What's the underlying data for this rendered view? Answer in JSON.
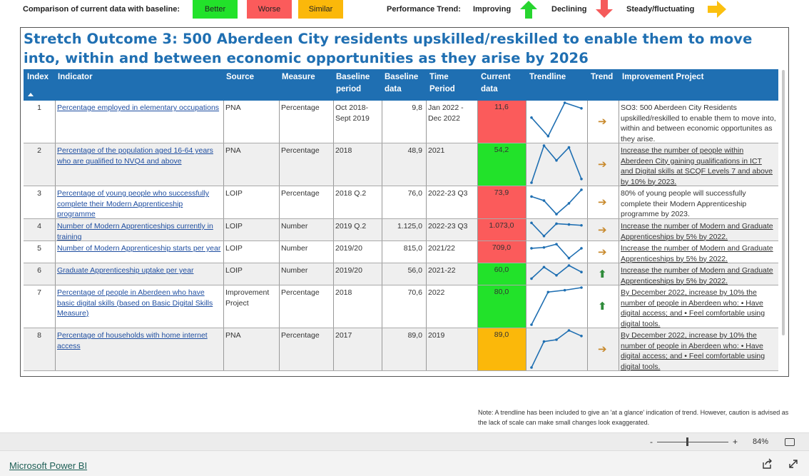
{
  "legend": {
    "comparison_label": "Comparison of current data with baseline:",
    "better": "Better",
    "worse": "Worse",
    "similar": "Similar",
    "performance_label": "Performance Trend:",
    "improving": "Improving",
    "declining": "Declining",
    "steady": "Steady/fluctuating",
    "colors": {
      "better": "#22e22a",
      "worse": "#fb5b5b",
      "similar": "#fbb80a",
      "improving": "#27d52f",
      "declining": "#f55a5a",
      "steady": "#fbc00f"
    }
  },
  "report": {
    "title": "Stretch Outcome 3: 500 Aberdeen City residents upskilled/reskilled to enable them to move into, within and between economic opportunities as they arise by 2026",
    "columns": {
      "index": "Index",
      "indicator": "Indicator",
      "source": "Source",
      "measure": "Measure",
      "baseline_period": "Baseline period",
      "baseline_data": "Baseline data",
      "time_period": "Time Period",
      "current_data": "Current data",
      "trendline": "Trendline",
      "trend": "Trend",
      "improvement": "Improvement Project"
    },
    "rows": [
      {
        "index": "1",
        "indicator": "Percentage employed in elementary occupations",
        "source": "PNA",
        "measure": "Percentage",
        "baseline_period": "Oct 2018- Sept 2019",
        "baseline_data": "9,8",
        "time_period": "Jan 2022 - Dec 2022",
        "current_data": "11,6",
        "status": "worse",
        "trend": "steady",
        "improvement": "SO3: 500 Aberdeen City Residents upskilled/reskilled to enable them to move into, within and between economic opportunites as they arise.",
        "spark": [
          0.6,
          0.1,
          1.0,
          0.85
        ]
      },
      {
        "index": "2",
        "indicator": "Percentage of the population aged 16-64 years who are qualified to NVQ4 and above",
        "source": "PNA",
        "measure": "Percentage",
        "baseline_period": "2018",
        "baseline_data": "48,9",
        "time_period": "2021",
        "current_data": "54,2",
        "status": "better",
        "trend": "steady",
        "improvement": "Increase the number of people within Aberdeen City gaining qualifications in ICT and Digital skills at SCQF Levels 7 and above by 10% by 2023.",
        "spark": [
          0.0,
          1.0,
          0.6,
          0.95,
          0.1
        ]
      },
      {
        "index": "3",
        "indicator": "Percentage of young people who successfully complete their Modern Apprenticeship programme",
        "source": "LOIP",
        "measure": "Percentage",
        "baseline_period": "2018 Q.2",
        "baseline_data": "76,0",
        "time_period": "2022-23 Q3",
        "current_data": "73,9",
        "status": "worse",
        "trend": "steady",
        "improvement": "80% of young people will successfully complete their Modern Apprenticeship programme by 2023.",
        "spark": [
          0.7,
          0.55,
          0.05,
          0.45,
          0.95
        ]
      },
      {
        "index": "4",
        "indicator": "Number of Modern Apprenticeships currently in training",
        "source": "LOIP",
        "measure": "Number",
        "baseline_period": "2019 Q.2",
        "baseline_data": "1.125,0",
        "time_period": "2022-23 Q3",
        "current_data": "1.073,0",
        "status": "worse",
        "trend": "steady",
        "improvement": "Increase the number of Modern and Graduate Apprenticeships by 5% by 2022.",
        "spark": [
          0.9,
          0.1,
          0.85,
          0.8,
          0.75
        ]
      },
      {
        "index": "5",
        "indicator": "Number of Modern Apprenticeship starts per year",
        "source": "LOIP",
        "measure": "Number",
        "baseline_period": "2019/20",
        "baseline_data": "815,0",
        "time_period": "2021/22",
        "current_data": "709,0",
        "status": "worse",
        "trend": "steady",
        "improvement": "Increase the number of Modern and Graduate Apprenticeships by 5% by 2022.",
        "spark": [
          0.7,
          0.75,
          0.95,
          0.1,
          0.7
        ]
      },
      {
        "index": "6",
        "indicator": "Graduate Apprenticeship uptake per year",
        "source": "LOIP",
        "measure": "Number",
        "baseline_period": "2019/20",
        "baseline_data": "56,0",
        "time_period": "2021-22",
        "current_data": "60,0",
        "status": "better",
        "trend": "improving",
        "improvement": "Increase the number of Modern and Graduate Apprenticeships by 5% by 2022.",
        "spark": [
          0.2,
          0.9,
          0.4,
          1.0,
          0.6
        ]
      },
      {
        "index": "7",
        "indicator": "Percentage of people in Aberdeen who have basic digital skills (based on Basic Digital Skills Measure)",
        "source": "Improvement Project",
        "measure": "Percentage",
        "baseline_period": "2018",
        "baseline_data": "70,6",
        "time_period": "2022",
        "current_data": "80,0",
        "status": "better",
        "trend": "improving",
        "improvement": "By December 2022, increase by 10% the number of people in Aberdeen who: • Have digital access; and • Feel comfortable using digital tools.",
        "spark": [
          0.0,
          0.88,
          0.93,
          1.0
        ]
      },
      {
        "index": "8",
        "indicator": "Percentage of households with home internet access",
        "source": "PNA",
        "measure": "Percentage",
        "baseline_period": "2017",
        "baseline_data": "89,0",
        "time_period": "2019",
        "current_data": "89,0",
        "status": "similar",
        "trend": "steady",
        "improvement": "By December 2022, increase by 10% the number of people in Aberdeen who: • Have digital access; and • Feel comfortable using digital tools.",
        "spark": [
          0.0,
          0.7,
          0.75,
          1.0,
          0.85
        ]
      }
    ],
    "note": "Note: A trendline has been included to give an 'at a glance' indication of trend.  However, caution is advised as the lack of scale can make small changes look exaggerated."
  },
  "zoom": {
    "minus": "-",
    "plus": "+",
    "percent": "84%"
  },
  "footer": {
    "brand_link": "Microsoft Power BI"
  }
}
